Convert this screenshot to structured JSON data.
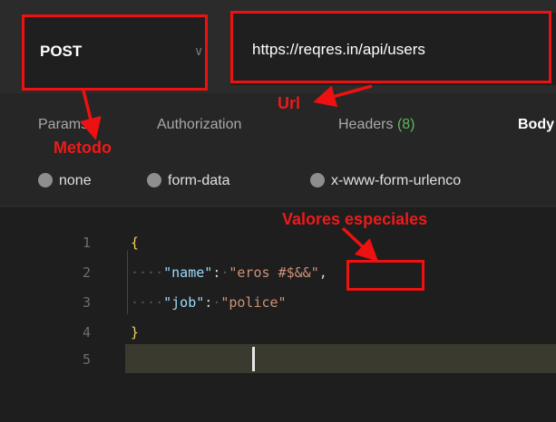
{
  "request": {
    "method": "POST",
    "url": "https://reqres.in/api/users"
  },
  "tabs": [
    {
      "label": "Params"
    },
    {
      "label": "Authorization"
    },
    {
      "label": "Headers",
      "count": "(8)"
    },
    {
      "label": "Body",
      "active": true
    }
  ],
  "body_types": [
    {
      "label": "none"
    },
    {
      "label": "form-data"
    },
    {
      "label": "x-www-form-urlenco"
    }
  ],
  "editor": {
    "line_numbers": [
      "1",
      "2",
      "3",
      "4",
      "5"
    ],
    "open_brace": "{",
    "close_brace": "}",
    "name_key": "\"name\"",
    "name_value_start": "\"eros ",
    "name_value_special": "#$&&",
    "name_value_end": "\"",
    "job_key": "\"job\"",
    "job_value": "\"police\""
  },
  "annotations": {
    "method": "Metodo",
    "url": "Url",
    "special": "Valores especiales",
    "color": "#ee1111"
  }
}
